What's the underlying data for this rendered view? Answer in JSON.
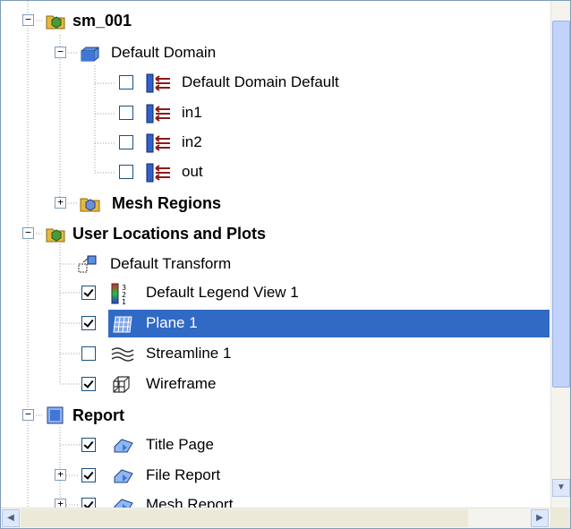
{
  "tree": {
    "sm_001": "sm_001",
    "default_domain": "Default Domain",
    "domain_default": "Default Domain Default",
    "in1": "in1",
    "in2": "in2",
    "out": "out",
    "mesh_regions": "Mesh Regions",
    "user_locations": "User Locations and Plots",
    "default_transform": "Default Transform",
    "default_legend": "Default Legend View 1",
    "plane1": "Plane 1",
    "streamline1": "Streamline 1",
    "wireframe": "Wireframe",
    "report": "Report",
    "title_page": "Title Page",
    "file_report": "File Report",
    "mesh_report": "Mesh Report"
  },
  "checked": {
    "domain_default": false,
    "in1": false,
    "in2": false,
    "out": false,
    "default_legend": true,
    "plane1": true,
    "streamline1": false,
    "wireframe": true,
    "title_page": true,
    "file_report": true,
    "mesh_report": true
  },
  "selected_item": "plane1",
  "colors": {
    "selection": "#316ac5",
    "boundary_arrow": "#8b1a1a",
    "boundary_plate": "#3060c8"
  }
}
